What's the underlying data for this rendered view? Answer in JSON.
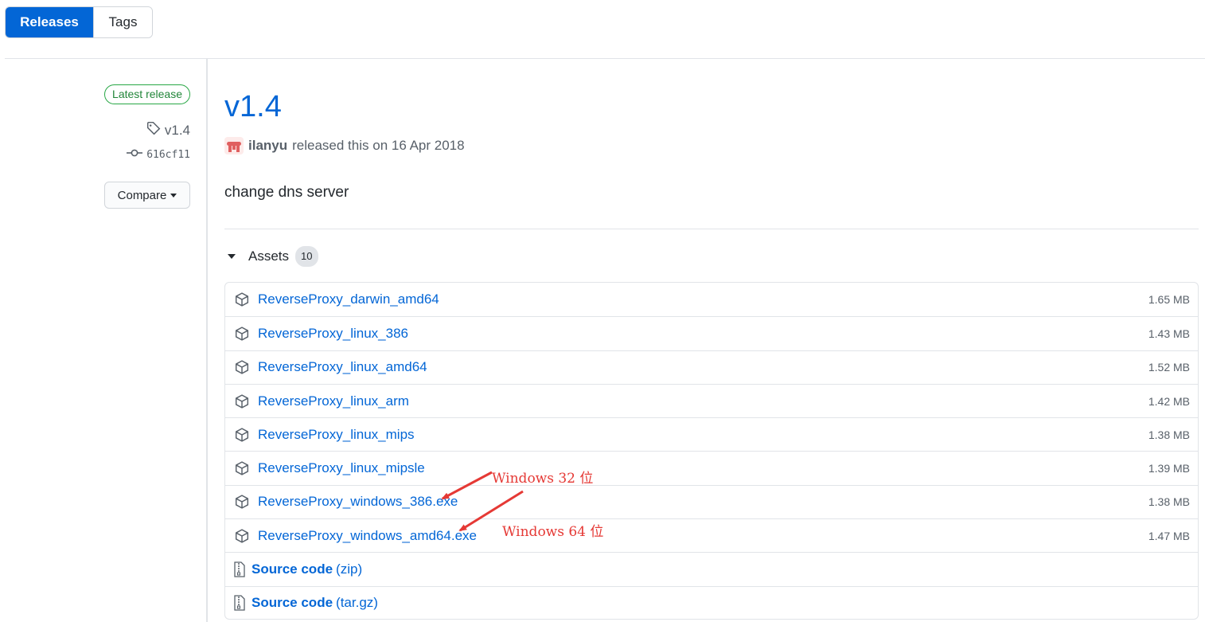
{
  "tabs": {
    "releases": "Releases",
    "tags": "Tags"
  },
  "meta": {
    "badge": "Latest release",
    "tag": "v1.4",
    "tag_icon": "tag-icon",
    "commit": "616cf11",
    "commit_icon": "git-commit-icon",
    "compare": "Compare"
  },
  "release": {
    "title": "v1.4",
    "author": "ilanyu",
    "released_text": "released this on 16 Apr 2018",
    "body": "change dns server"
  },
  "assets": {
    "label": "Assets",
    "count": "10",
    "items": [
      {
        "name": "ReverseProxy_darwin_amd64",
        "size": "1.65 MB"
      },
      {
        "name": "ReverseProxy_linux_386",
        "size": "1.43 MB"
      },
      {
        "name": "ReverseProxy_linux_amd64",
        "size": "1.52 MB"
      },
      {
        "name": "ReverseProxy_linux_arm",
        "size": "1.42 MB"
      },
      {
        "name": "ReverseProxy_linux_mips",
        "size": "1.38 MB"
      },
      {
        "name": "ReverseProxy_linux_mipsle",
        "size": "1.39 MB"
      },
      {
        "name": "ReverseProxy_windows_386.exe",
        "size": "1.38 MB"
      },
      {
        "name": "ReverseProxy_windows_amd64.exe",
        "size": "1.47 MB"
      }
    ],
    "sources": [
      {
        "label": "Source code",
        "ext": "(zip)"
      },
      {
        "label": "Source code",
        "ext": "(tar.gz)"
      }
    ]
  },
  "annotations": {
    "win32": "Windows 32 位",
    "win64": "Windows 64 位",
    "color": "#e53935"
  },
  "colors": {
    "accent": "#0366d6",
    "badge_green": "#28a745"
  }
}
